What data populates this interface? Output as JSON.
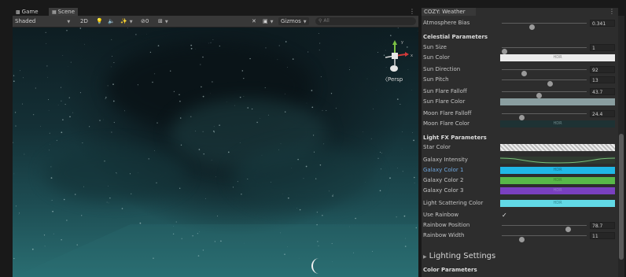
{
  "scene": {
    "tabs": [
      {
        "label": "Game",
        "icon": "gamepad-icon"
      },
      {
        "label": "Scene",
        "icon": "grid-icon"
      }
    ],
    "toolbar": {
      "shading_mode": "Shaded",
      "view_2d": "2D",
      "fx_count": "0",
      "gizmos_label": "Gizmos",
      "search_placeholder": "All"
    },
    "view_label": "Persp"
  },
  "inspector": {
    "tab_label": "COZY: Weather",
    "atmosphere_bias": {
      "label": "Atmosphere Bias",
      "value": "0.341",
      "fraction": 0.36
    },
    "celestial": {
      "header": "Celestial Parameters",
      "sun_size": {
        "label": "Sun Size",
        "value": "1",
        "fraction": 0.03
      },
      "sun_color": {
        "label": "Sun Color",
        "swatch": "#ececec",
        "text": "HDR"
      },
      "sun_direction": {
        "label": "Sun Direction",
        "value": "92",
        "fraction": 0.26
      },
      "sun_pitch": {
        "label": "Sun Pitch",
        "value": "13",
        "fraction": 0.57
      },
      "sun_flare_falloff": {
        "label": "Sun Flare Falloff",
        "value": "43.7",
        "fraction": 0.44
      },
      "sun_flare_color": {
        "label": "Sun Flare Color",
        "swatch": "#8a9ea0",
        "text": ""
      },
      "moon_flare_falloff": {
        "label": "Moon Flare Falloff",
        "value": "24.4",
        "fraction": 0.24
      },
      "moon_flare_color": {
        "label": "Moon Flare Color",
        "swatch": "#1e3234",
        "text": "HDR"
      }
    },
    "light_fx": {
      "header": "Light FX Parameters",
      "star_color": {
        "label": "Star Color",
        "swatch": "#e8e8e8"
      },
      "galaxy_intensity": {
        "label": "Galaxy Intensity",
        "swatch": "#4a7a4a"
      },
      "galaxy_color_1": {
        "label": "Galaxy Color 1",
        "swatch": "#20b8e6",
        "text": "HDR"
      },
      "galaxy_color_2": {
        "label": "Galaxy Color 2",
        "swatch": "#58b848",
        "text": "HDR"
      },
      "galaxy_color_3": {
        "label": "Galaxy Color 3",
        "swatch": "#7a40c0",
        "text": "HDR"
      },
      "light_scattering_color": {
        "label": "Light Scattering Color",
        "swatch": "#62d9e6",
        "text": "HDR"
      },
      "use_rainbow": {
        "label": "Use Rainbow",
        "checked": true,
        "mark": "✓"
      },
      "rainbow_position": {
        "label": "Rainbow Position",
        "value": "78.7",
        "fraction": 0.78
      },
      "rainbow_width": {
        "label": "Rainbow Width",
        "value": "11",
        "fraction": 0.24
      }
    },
    "lighting": {
      "header": "Lighting Settings",
      "sub_header": "Color Parameters"
    }
  }
}
